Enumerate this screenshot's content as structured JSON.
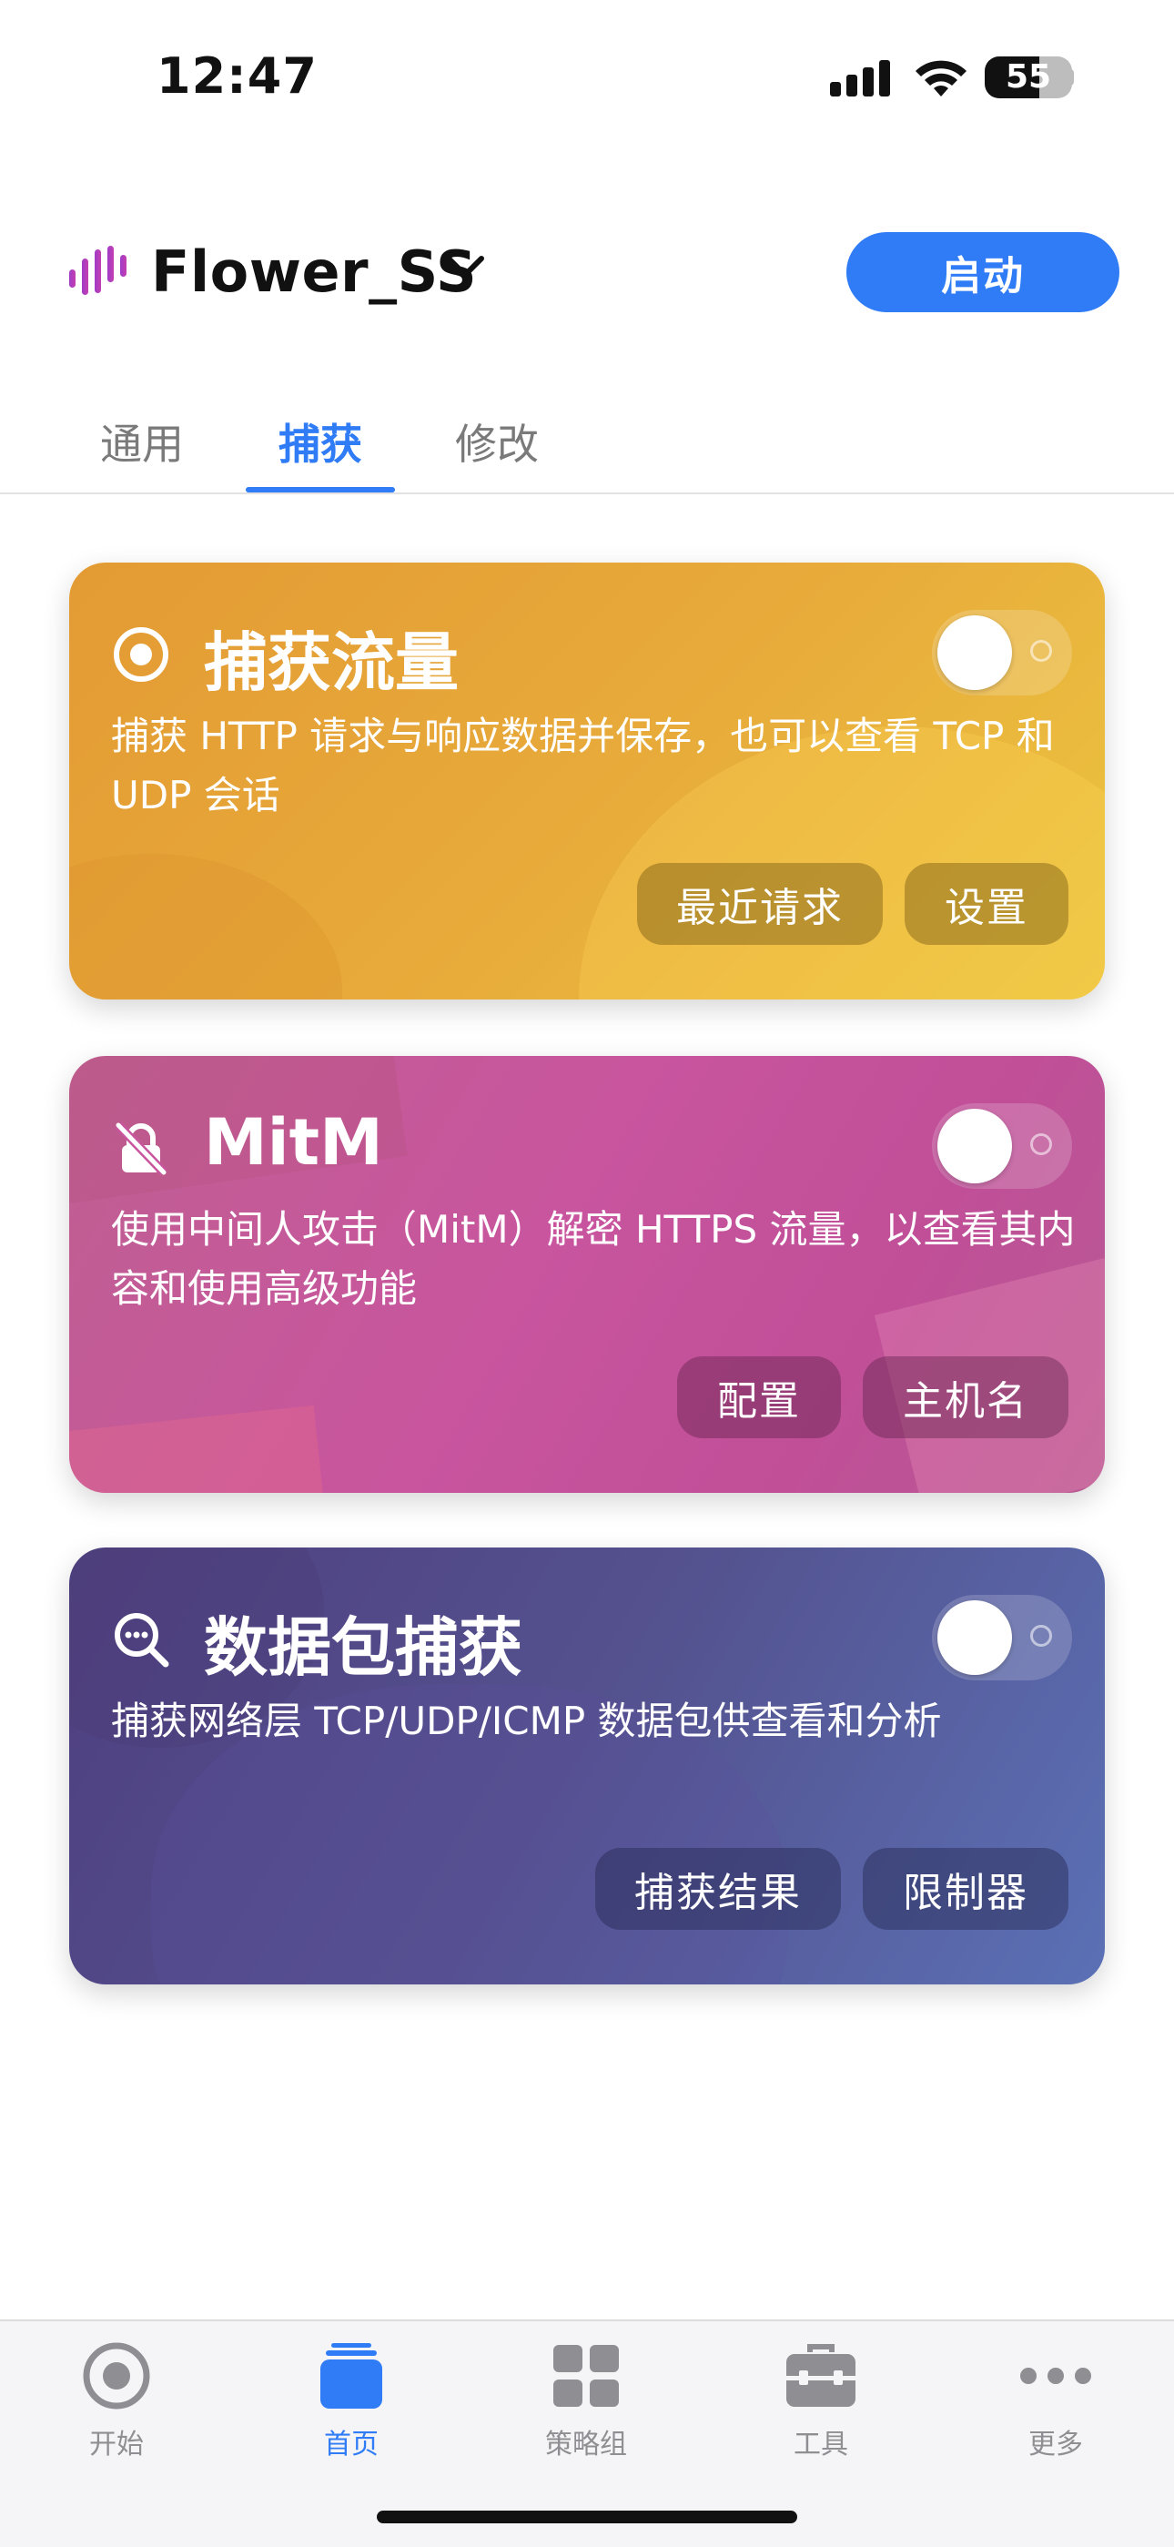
{
  "status_bar": {
    "time": "12:47",
    "battery": "55"
  },
  "header": {
    "profile_name": "Flower_SS",
    "start_label": "启动"
  },
  "tabs": [
    {
      "label": "通用",
      "active": false
    },
    {
      "label": "捕获",
      "active": true
    },
    {
      "label": "修改",
      "active": false
    }
  ],
  "cards": [
    {
      "title": "捕获流量",
      "description": "捕获 HTTP 请求与响应数据并保存，也可以查看 TCP 和 UDP 会话",
      "enabled": false,
      "buttons": [
        "最近请求",
        "设置"
      ],
      "icon": "record-icon"
    },
    {
      "title": "MitM",
      "description": "使用中间人攻击（MitM）解密 HTTPS 流量，以查看其内容和使用高级功能",
      "enabled": false,
      "buttons": [
        "配置",
        "主机名"
      ],
      "icon": "lock-slash-icon"
    },
    {
      "title": "数据包捕获",
      "description": "捕获网络层 TCP/UDP/ICMP 数据包供查看和分析",
      "enabled": false,
      "buttons": [
        "捕获结果",
        "限制器"
      ],
      "icon": "magnifier-icon"
    }
  ],
  "tabbar": [
    {
      "label": "开始",
      "icon": "record-icon",
      "active": false
    },
    {
      "label": "首页",
      "icon": "stack-icon",
      "active": true
    },
    {
      "label": "策略组",
      "icon": "grid-icon",
      "active": false
    },
    {
      "label": "工具",
      "icon": "toolbox-icon",
      "active": false
    },
    {
      "label": "更多",
      "icon": "more-dots-icon",
      "active": false
    }
  ],
  "colors": {
    "accent": "#2f7cf6",
    "card1": "#e8ac3b",
    "card2": "#c8559e",
    "card3": "#54528f"
  }
}
